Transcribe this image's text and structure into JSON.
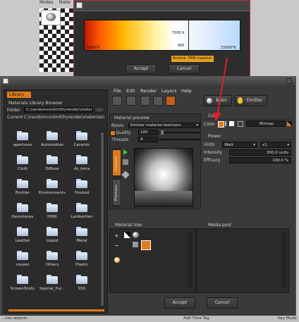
{
  "background_app": {
    "tabs": [
      "Modes",
      "Mater"
    ]
  },
  "color_dialog": {
    "gradient_labels": {
      "left": "1000°K",
      "mark_top": "7000 K",
      "mark_bottom": "065",
      "right": "15000°K"
    },
    "tooltip": "Archive .FRM material",
    "accept_label": "Accept",
    "cancel_label": "Cancel"
  },
  "main_dialog": {
    "library": {
      "tab_label": "Library",
      "browser_title": "Materials Library Browser",
      "folder_label": "Folder",
      "folder_value": "C:\\randomcontrol\\fryrender\\materi",
      "folder_button": "...",
      "current_label": "Current",
      "current_value": "C:\\randomcontrol\\fryrender\\materials\\",
      "folders": [
        "apertures",
        "Automotive",
        "Ceramic",
        "Cloth",
        "Diffuse",
        "dx_terra",
        "Emitter",
        "Environments",
        "Frosted",
        "Gemstones",
        "HDRI",
        "Lambertian",
        "Leather",
        "Liquid",
        "Metal",
        "museo",
        "Others",
        "Plastic",
        "ScreenShots",
        "Special_Pur...",
        "SSS"
      ]
    },
    "menu": [
      "File",
      "Edit",
      "Render",
      "Layers",
      "Help"
    ],
    "type_buttons": {
      "basic": "Basic",
      "emitter": "Emitter"
    },
    "material_preview": {
      "title": "Material preview",
      "room_label": "Room",
      "room_value": "Emitter material testroom",
      "quality_label": "Quality",
      "quality_value": "100",
      "threads_label": "Threads",
      "threads_value": "4",
      "tabs": [
        "Current",
        "Previous"
      ]
    },
    "color": {
      "section_label": "Color",
      "row_label": "Color",
      "bitmap_label": "Bitmap"
    },
    "power": {
      "section_label": "Power",
      "units_label": "Units",
      "units_value": "Watt",
      "multiplier": "x1",
      "intensity_label": "Intensity",
      "intensity_value": "300.0 units",
      "efficacy_label": "Efficacy",
      "efficacy_value": "100.0 %"
    },
    "material_tree_label": "Material tree",
    "media_pool_label": "Media pool",
    "accept_label": "Accept",
    "cancel_label": "Cancel"
  },
  "status_bar": {
    "left": "...ose objects",
    "mid": "Add Time Tag",
    "right": "Key Mode"
  },
  "colors": {
    "accent": "#e07b1a",
    "dialog_bg": "#3a3a3a",
    "panel_bg": "#2b2b2b",
    "highlight_border": "#b83040"
  }
}
